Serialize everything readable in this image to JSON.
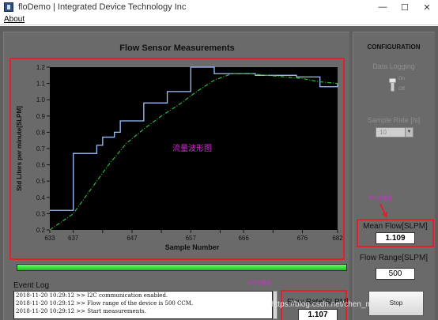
{
  "window": {
    "title": "floDemo | Integrated Device Technology Inc",
    "controls": [
      "—",
      "☐",
      "✕"
    ]
  },
  "menu": {
    "items": [
      "About"
    ]
  },
  "chart": {
    "heading": "Flow Sensor Measurements"
  },
  "chart_data": {
    "type": "line",
    "title": "Flow Sensor Measurements",
    "xlabel": "Sample Number",
    "ylabel": "Std Liters per minute[SLPM]",
    "xlim": [
      633,
      682
    ],
    "ylim": [
      0.2,
      1.2
    ],
    "x_ticks": [
      633,
      637,
      642,
      647,
      652,
      657,
      662,
      666,
      671,
      676,
      682
    ],
    "x_tick_labels": [
      "633",
      "637",
      "",
      "647",
      "",
      "657",
      "",
      "666",
      "",
      "676",
      "682"
    ],
    "y_ticks": [
      0.2,
      0.3,
      0.4,
      0.5,
      0.6,
      0.7,
      0.8,
      0.9,
      1.0,
      1.1,
      1.2
    ],
    "y_tick_labels": [
      "0.2",
      "0.3",
      "0.4",
      "0.5",
      "0.6",
      "0.7",
      "0.8",
      "0.9",
      "1.0",
      "1.1",
      "1.2"
    ],
    "grid": false,
    "series": [
      {
        "style": "step",
        "color": "#9bc2ff",
        "x": [
          633,
          636,
          637,
          640,
          641,
          642,
          644,
          645,
          648,
          649,
          652,
          653,
          656,
          657,
          660,
          661,
          668,
          675,
          679,
          681,
          682
        ],
        "y": [
          0.32,
          0.32,
          0.67,
          0.67,
          0.72,
          0.77,
          0.8,
          0.87,
          0.87,
          0.98,
          0.98,
          1.05,
          1.05,
          1.2,
          1.2,
          1.16,
          1.15,
          1.14,
          1.08,
          1.08,
          1.1
        ]
      },
      {
        "style": "dashdot",
        "color": "#2fb83c",
        "x": [
          633,
          635,
          637,
          640,
          643,
          646,
          649,
          652,
          655,
          658,
          661,
          664,
          667,
          670,
          673,
          676,
          679,
          682
        ],
        "y": [
          0.2,
          0.25,
          0.3,
          0.45,
          0.6,
          0.73,
          0.82,
          0.9,
          0.97,
          1.05,
          1.12,
          1.16,
          1.16,
          1.15,
          1.14,
          1.13,
          1.11,
          1.1
        ]
      }
    ],
    "annotation": "流量波形图"
  },
  "progress": {
    "value": 1.0
  },
  "event_log": {
    "label": "Event Log",
    "lines": [
      "2018-11-20 10:29:12 >> I2C communication enabled.",
      "2018-11-20 10:29:12 >> Flow range of the device is 500 CCM.",
      "2018-11-20 10:29:12 >> Start measurements."
    ]
  },
  "flow_rate": {
    "label": "Flow Rate[SLPM]",
    "value": "1.107"
  },
  "config": {
    "title": "CONFIGURATION",
    "data_logging_label": "Data Logging",
    "on_label": "On",
    "off_label": "Off",
    "sample_rate_label": "Sample Rate [/s]",
    "sample_rate_value": "10"
  },
  "mean_flow": {
    "label": "Mean Flow[SLPM]",
    "value": "1.109"
  },
  "flow_range": {
    "label": "Flow Range[SLPM]",
    "value": "500"
  },
  "stop_button": {
    "label": "Stop"
  },
  "annotations": {
    "mean_note": "平均流量值",
    "rate_note": "实时流量值"
  },
  "watermark": "https://blog.csdn.net/chen_me",
  "colors": {
    "panel": "#6a6a6a",
    "frame": "#e0202a",
    "plot_bg": "#000000",
    "progress": "#2fe62f",
    "note": "#d02fd0"
  }
}
